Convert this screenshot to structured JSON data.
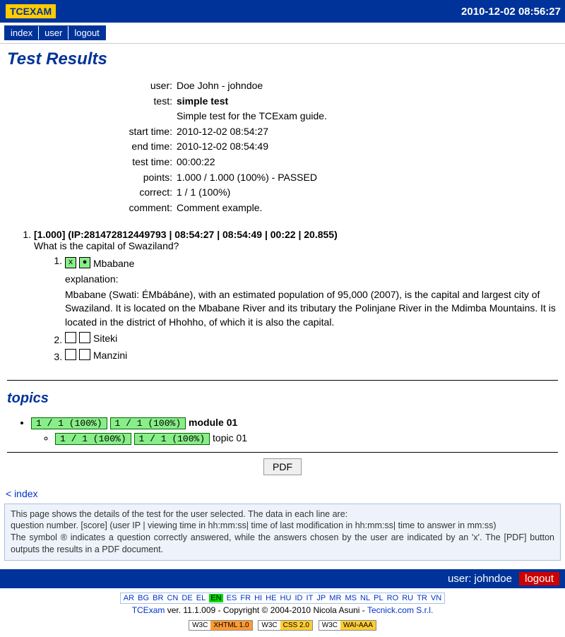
{
  "header": {
    "logo_tc": "TC",
    "logo_exam": "EXAM",
    "timestamp": "2010-12-02 08:56:27"
  },
  "nav": {
    "index": "index",
    "user": "user",
    "logout": "logout"
  },
  "page_title": "Test Results",
  "summary": {
    "user_label": "user:",
    "user_value": "Doe John - johndoe",
    "test_label": "test:",
    "test_value": "simple test",
    "test_desc": "Simple test for the TCExam guide.",
    "start_label": "start time:",
    "start_value": "2010-12-02 08:54:27",
    "end_label": "end time:",
    "end_value": "2010-12-02 08:54:49",
    "testtime_label": "test time:",
    "testtime_value": "00:00:22",
    "points_label": "points:",
    "points_value": "1.000 / 1.000 (100%) - PASSED",
    "correct_label": "correct:",
    "correct_value": "1 / 1 (100%)",
    "comment_label": "comment:",
    "comment_value": "Comment example."
  },
  "question": {
    "header": "[1.000] (IP:281472812449793 | 08:54:27 | 08:54:49 | 00:22 | 20.855)",
    "text": "What is the capital of Swaziland?",
    "answers": [
      {
        "mark1": "x",
        "mark2": "●",
        "green": true,
        "text": "Mbabane",
        "explanation_label": "explanation:",
        "explanation": "Mbabane (Swati: ÉMbábáne), with an estimated population of 95,000 (2007), is the capital and largest city of Swaziland. It is located on the Mbabane River and its tributary the Polinjane River in the Mdimba Mountains. It is located in the district of Hhohho, of which it is also the capital."
      },
      {
        "mark1": "",
        "mark2": "",
        "green": false,
        "text": "Siteki"
      },
      {
        "mark1": "",
        "mark2": "",
        "green": false,
        "text": "Manzini"
      }
    ]
  },
  "topics": {
    "title": "topics",
    "module_badge1": "1 / 1 (100%)",
    "module_badge2": "1 / 1 (100%)",
    "module_name": "module 01",
    "topic_badge1": "1 / 1 (100%)",
    "topic_badge2": "1 / 1 (100%)",
    "topic_name": "topic 01"
  },
  "pdf_button": "PDF",
  "back_link": "< index",
  "help_text": "This page shows the details of the test for the user selected. The data in each line are:\nquestion number. [score] (user IP | viewing time in hh:mm:ss| time of last modification in hh:mm:ss| time to answer in mm:ss)\nThe symbol ® indicates a question correctly answered, while the answers chosen by the user are indicated by an 'x'. The [PDF] button outputs the results in a PDF document.",
  "footer": {
    "user_label": "user: johndoe",
    "logout": "logout"
  },
  "langs": [
    "AR",
    "BG",
    "BR",
    "CN",
    "DE",
    "EL",
    "EN",
    "ES",
    "FR",
    "HI",
    "HE",
    "HU",
    "ID",
    "IT",
    "JP",
    "MR",
    "MS",
    "NL",
    "PL",
    "RO",
    "RU",
    "TR",
    "VN"
  ],
  "lang_active": "EN",
  "copyright": {
    "app": "TCExam",
    "ver": " ver. 11.1.009 - Copyright © 2004-2010 Nicola Asuni - ",
    "company": "Tecnick.com S.r.l."
  },
  "w3c": {
    "xhtml_l": "W3C",
    "xhtml_r": "XHTML 1.0",
    "css_l": "W3C",
    "css_r": "CSS 2.0",
    "wai_l": "W3C",
    "wai_r": "WAI-AAA"
  }
}
